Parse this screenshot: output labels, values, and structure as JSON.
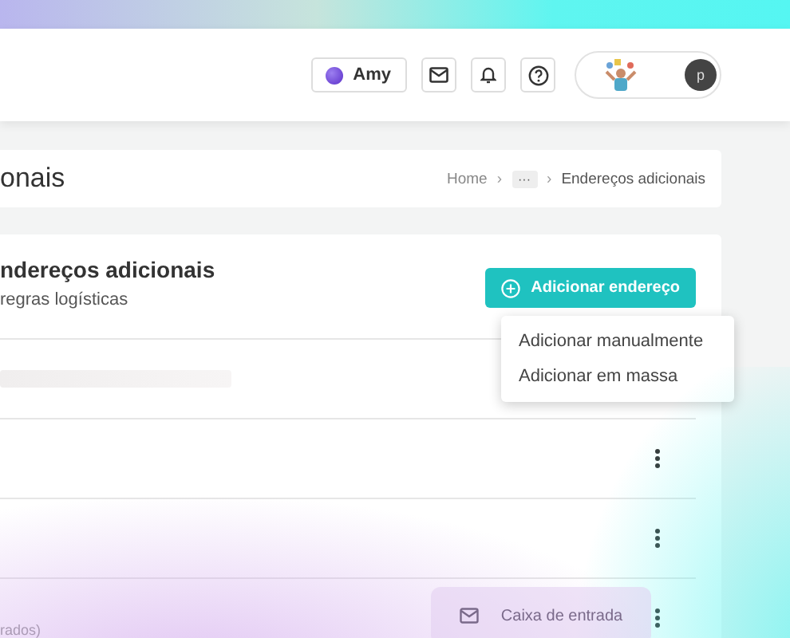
{
  "header": {
    "workspace": "Amy",
    "avatar_letter": "p"
  },
  "page_title": "onais",
  "breadcrumb": [
    {
      "label": "Home",
      "kind": "link"
    },
    {
      "label": "›",
      "kind": "sep"
    },
    {
      "label": "···",
      "kind": "more"
    },
    {
      "label": "›",
      "kind": "sep"
    },
    {
      "label": "Endereços adicionais",
      "kind": "current"
    }
  ],
  "card": {
    "title": "ndereços adicionais",
    "subtitle": "regras logísticas",
    "add_button": "Adicionar endereço",
    "menu": [
      "Adicionar manualmente",
      "Adicionar em massa"
    ],
    "rows": [
      {
        "kind": "skeleton",
        "menu_button": false
      },
      {
        "kind": "blank",
        "menu_button": true
      },
      {
        "kind": "blank",
        "menu_button": true
      },
      {
        "kind": "note",
        "text": "rados)",
        "menu_button": true
      }
    ]
  },
  "floating_chip": "Caixa de entrada"
}
